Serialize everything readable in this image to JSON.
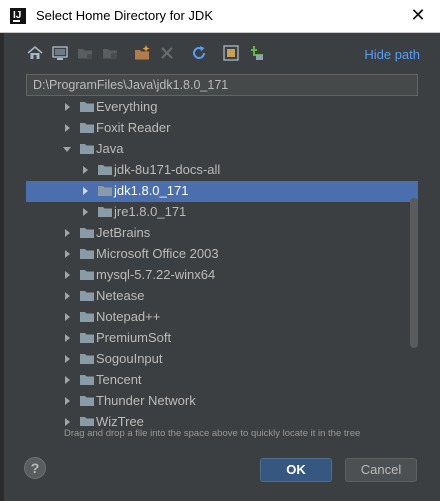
{
  "window": {
    "title": "Select Home Directory for JDK",
    "close_glyph": "✕",
    "app_icon": "intellij-icon",
    "app_icon_letter": "IJ"
  },
  "toolbar": {
    "icons": [
      "home-icon",
      "desktop-icon",
      "project-folder-icon",
      "module-folder-icon",
      "new-folder-icon",
      "delete-icon",
      "refresh-icon",
      "show-hidden-icon",
      "new-file-icon"
    ],
    "hide_path_label": "Hide path"
  },
  "path_field": {
    "value": "D:\\ProgramFiles\\Java\\jdk1.8.0_171"
  },
  "tree": {
    "items": [
      {
        "label": "Everything",
        "level": 0,
        "expanded": false,
        "selected": false
      },
      {
        "label": "Foxit Reader",
        "level": 0,
        "expanded": false,
        "selected": false
      },
      {
        "label": "Java",
        "level": 0,
        "expanded": true,
        "selected": false
      },
      {
        "label": "jdk-8u171-docs-all",
        "level": 1,
        "expanded": false,
        "selected": false
      },
      {
        "label": "jdk1.8.0_171",
        "level": 1,
        "expanded": false,
        "selected": true
      },
      {
        "label": "jre1.8.0_171",
        "level": 1,
        "expanded": false,
        "selected": false
      },
      {
        "label": "JetBrains",
        "level": 0,
        "expanded": false,
        "selected": false
      },
      {
        "label": "Microsoft Office 2003",
        "level": 0,
        "expanded": false,
        "selected": false
      },
      {
        "label": "mysql-5.7.22-winx64",
        "level": 0,
        "expanded": false,
        "selected": false
      },
      {
        "label": "Netease",
        "level": 0,
        "expanded": false,
        "selected": false
      },
      {
        "label": "Notepad++",
        "level": 0,
        "expanded": false,
        "selected": false
      },
      {
        "label": "PremiumSoft",
        "level": 0,
        "expanded": false,
        "selected": false
      },
      {
        "label": "SogouInput",
        "level": 0,
        "expanded": false,
        "selected": false
      },
      {
        "label": "Tencent",
        "level": 0,
        "expanded": false,
        "selected": false
      },
      {
        "label": "Thunder Network",
        "level": 0,
        "expanded": false,
        "selected": false
      },
      {
        "label": "WizTree",
        "level": 0,
        "expanded": false,
        "selected": false
      }
    ]
  },
  "hint": "Drag and drop a file into the space above to quickly locate it in the tree",
  "footer": {
    "help_label": "?",
    "ok_label": "OK",
    "cancel_label": "Cancel"
  },
  "colors": {
    "background": "#3c3f41",
    "selection": "#4b6eaf",
    "link": "#589df6",
    "folder": "#8a9ba8"
  }
}
